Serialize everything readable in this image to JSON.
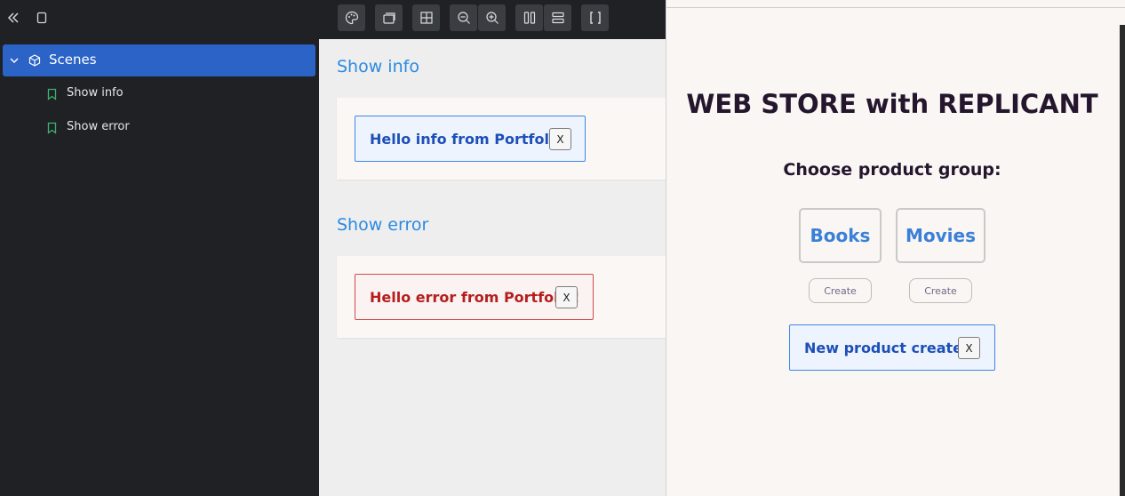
{
  "sidebar": {
    "root_label": "Scenes",
    "stories": [
      {
        "label": "Show info"
      },
      {
        "label": "Show error"
      }
    ]
  },
  "toolbar": {
    "buttons": [
      "palette-icon",
      "layers-icon",
      "grid-icon",
      "zoom-out-icon",
      "zoom-in-icon",
      "columns-icon",
      "rows-icon",
      "brackets-icon"
    ]
  },
  "canvas": {
    "stories": [
      {
        "title": "Show info",
        "toast_text": "Hello info from Portfolio!",
        "close_label": "X"
      },
      {
        "title": "Show error",
        "toast_text": "Hello error from Portfolio!",
        "close_label": "X"
      }
    ]
  },
  "preview": {
    "title": "WEB STORE with REPLICANT",
    "subtitle": "Choose product group:",
    "groups": [
      {
        "label": "Books",
        "create_label": "Create"
      },
      {
        "label": "Movies",
        "create_label": "Create"
      }
    ],
    "toast_text": "New product created!",
    "close_label": "X"
  },
  "colors": {
    "sidebar_bg": "#1f2125",
    "selected_bg": "#2b63c6",
    "link_blue": "#2b8ae2",
    "info_border": "#3f86e6",
    "error_border": "#d24a4a",
    "preview_bg": "#faf6f3"
  }
}
